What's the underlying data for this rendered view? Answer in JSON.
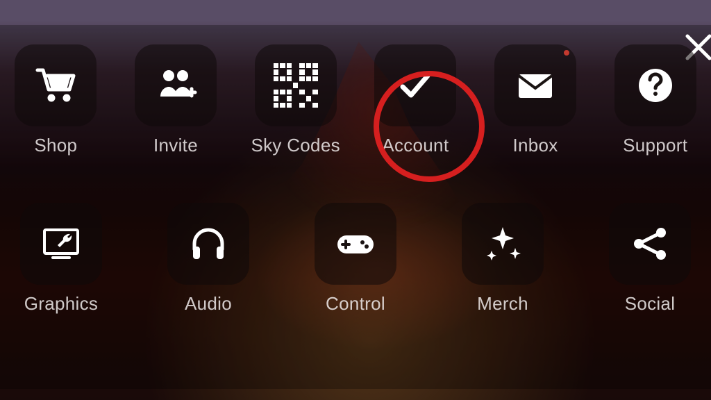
{
  "colors": {
    "highlight": "#d61f1f",
    "notif": "#c43a2f"
  },
  "close_label": "Close",
  "highlighted_item": "account",
  "row1": [
    {
      "id": "shop",
      "label": "Shop",
      "icon": "cart-icon"
    },
    {
      "id": "invite",
      "label": "Invite",
      "icon": "invite-icon"
    },
    {
      "id": "skycodes",
      "label": "Sky Codes",
      "icon": "qr-icon"
    },
    {
      "id": "account",
      "label": "Account",
      "icon": "check-icon"
    },
    {
      "id": "inbox",
      "label": "Inbox",
      "icon": "envelope-icon",
      "notif": true
    },
    {
      "id": "support",
      "label": "Support",
      "icon": "help-icon"
    }
  ],
  "row2": [
    {
      "id": "graphics",
      "label": "Graphics",
      "icon": "monitor-wrench-icon"
    },
    {
      "id": "audio",
      "label": "Audio",
      "icon": "headphones-icon"
    },
    {
      "id": "control",
      "label": "Control",
      "icon": "gamepad-icon"
    },
    {
      "id": "merch",
      "label": "Merch",
      "icon": "sparkle-icon"
    },
    {
      "id": "social",
      "label": "Social",
      "icon": "share-icon"
    }
  ]
}
